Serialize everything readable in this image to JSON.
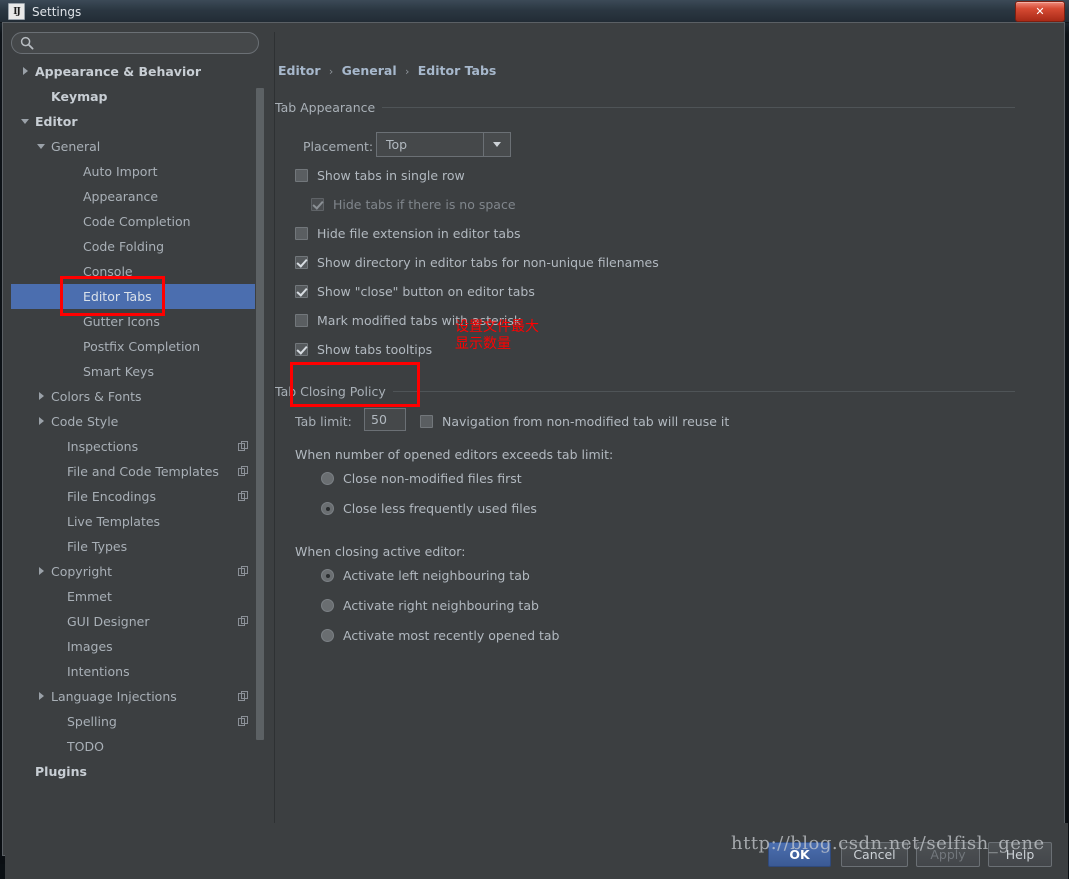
{
  "window": {
    "title": "Settings",
    "logo_text": "IJ",
    "close_label": "✕"
  },
  "search": {
    "value": "",
    "placeholder": ""
  },
  "sidebar": {
    "items": [
      {
        "label": "Appearance & Behavior",
        "indent": 0,
        "twisty": "right",
        "bold": true,
        "copy": false,
        "selected": false
      },
      {
        "label": "Keymap",
        "indent": 1,
        "twisty": "none",
        "bold": true,
        "copy": false,
        "selected": false
      },
      {
        "label": "Editor",
        "indent": 0,
        "twisty": "down",
        "bold": true,
        "copy": false,
        "selected": false
      },
      {
        "label": "General",
        "indent": 1,
        "twisty": "down",
        "bold": false,
        "copy": false,
        "selected": false
      },
      {
        "label": "Auto Import",
        "indent": 3,
        "twisty": "none",
        "bold": false,
        "copy": false,
        "selected": false
      },
      {
        "label": "Appearance",
        "indent": 3,
        "twisty": "none",
        "bold": false,
        "copy": false,
        "selected": false
      },
      {
        "label": "Code Completion",
        "indent": 3,
        "twisty": "none",
        "bold": false,
        "copy": false,
        "selected": false
      },
      {
        "label": "Code Folding",
        "indent": 3,
        "twisty": "none",
        "bold": false,
        "copy": false,
        "selected": false
      },
      {
        "label": "Console",
        "indent": 3,
        "twisty": "none",
        "bold": false,
        "copy": false,
        "selected": false
      },
      {
        "label": "Editor Tabs",
        "indent": 3,
        "twisty": "none",
        "bold": false,
        "copy": false,
        "selected": true
      },
      {
        "label": "Gutter Icons",
        "indent": 3,
        "twisty": "none",
        "bold": false,
        "copy": false,
        "selected": false
      },
      {
        "label": "Postfix Completion",
        "indent": 3,
        "twisty": "none",
        "bold": false,
        "copy": false,
        "selected": false
      },
      {
        "label": "Smart Keys",
        "indent": 3,
        "twisty": "none",
        "bold": false,
        "copy": false,
        "selected": false
      },
      {
        "label": "Colors & Fonts",
        "indent": 1,
        "twisty": "right",
        "bold": false,
        "copy": false,
        "selected": false
      },
      {
        "label": "Code Style",
        "indent": 1,
        "twisty": "right",
        "bold": false,
        "copy": false,
        "selected": false
      },
      {
        "label": "Inspections",
        "indent": 2,
        "twisty": "none",
        "bold": false,
        "copy": true,
        "selected": false
      },
      {
        "label": "File and Code Templates",
        "indent": 2,
        "twisty": "none",
        "bold": false,
        "copy": true,
        "selected": false
      },
      {
        "label": "File Encodings",
        "indent": 2,
        "twisty": "none",
        "bold": false,
        "copy": true,
        "selected": false
      },
      {
        "label": "Live Templates",
        "indent": 2,
        "twisty": "none",
        "bold": false,
        "copy": false,
        "selected": false
      },
      {
        "label": "File Types",
        "indent": 2,
        "twisty": "none",
        "bold": false,
        "copy": false,
        "selected": false
      },
      {
        "label": "Copyright",
        "indent": 1,
        "twisty": "right",
        "bold": false,
        "copy": true,
        "selected": false
      },
      {
        "label": "Emmet",
        "indent": 2,
        "twisty": "none",
        "bold": false,
        "copy": false,
        "selected": false
      },
      {
        "label": "GUI Designer",
        "indent": 2,
        "twisty": "none",
        "bold": false,
        "copy": true,
        "selected": false
      },
      {
        "label": "Images",
        "indent": 2,
        "twisty": "none",
        "bold": false,
        "copy": false,
        "selected": false
      },
      {
        "label": "Intentions",
        "indent": 2,
        "twisty": "none",
        "bold": false,
        "copy": false,
        "selected": false
      },
      {
        "label": "Language Injections",
        "indent": 1,
        "twisty": "right",
        "bold": false,
        "copy": true,
        "selected": false
      },
      {
        "label": "Spelling",
        "indent": 2,
        "twisty": "none",
        "bold": false,
        "copy": true,
        "selected": false
      },
      {
        "label": "TODO",
        "indent": 2,
        "twisty": "none",
        "bold": false,
        "copy": false,
        "selected": false
      },
      {
        "label": "Plugins",
        "indent": 0,
        "twisty": "none",
        "bold": true,
        "copy": false,
        "selected": false
      }
    ]
  },
  "breadcrumb": {
    "part1": "Editor",
    "part2": "General",
    "part3": "Editor Tabs",
    "separator": "›"
  },
  "tab_appearance": {
    "group_title": "Tab Appearance",
    "placement_label": "Placement:",
    "placement_value": "Top",
    "checkboxes": [
      {
        "label": "Show tabs in single row",
        "checked": false,
        "disabled": false
      },
      {
        "label": "Hide tabs if there is no space",
        "checked": true,
        "disabled": true
      },
      {
        "label": "Hide file extension in editor tabs",
        "checked": false,
        "disabled": false
      },
      {
        "label": "Show directory in editor tabs for non-unique filenames",
        "checked": true,
        "disabled": false
      },
      {
        "label": "Show \"close\" button on editor tabs",
        "checked": true,
        "disabled": false
      },
      {
        "label": "Mark modified tabs with asterisk",
        "checked": false,
        "disabled": false
      },
      {
        "label": "Show tabs tooltips",
        "checked": true,
        "disabled": false
      }
    ]
  },
  "tab_closing": {
    "group_title": "Tab Closing Policy",
    "tab_limit_label": "Tab limit:",
    "tab_limit_value": "50",
    "navigation_checkbox": {
      "label": "Navigation from non-modified tab will reuse it",
      "checked": false
    },
    "exceeds_header": "When number of opened editors exceeds tab limit:",
    "exceeds_options": [
      {
        "label": "Close non-modified files first",
        "checked": false
      },
      {
        "label": "Close less frequently used files",
        "checked": true
      }
    ],
    "closing_header": "When closing active editor:",
    "closing_options": [
      {
        "label": "Activate left neighbouring tab",
        "checked": true
      },
      {
        "label": "Activate right neighbouring tab",
        "checked": false
      },
      {
        "label": "Activate most recently opened tab",
        "checked": false
      }
    ]
  },
  "annotation": {
    "text": "设置文件最大\n显示数量",
    "color": "#ff0000"
  },
  "buttons": {
    "ok": "OK",
    "cancel": "Cancel",
    "apply": "Apply",
    "help": "Help"
  },
  "watermark": "http://blog.csdn.net/selfish_gene",
  "colors": {
    "selection": "#4b6eaf",
    "panel": "#3c3f41",
    "text": "#a9b0b7",
    "annotation": "#ff0000"
  }
}
